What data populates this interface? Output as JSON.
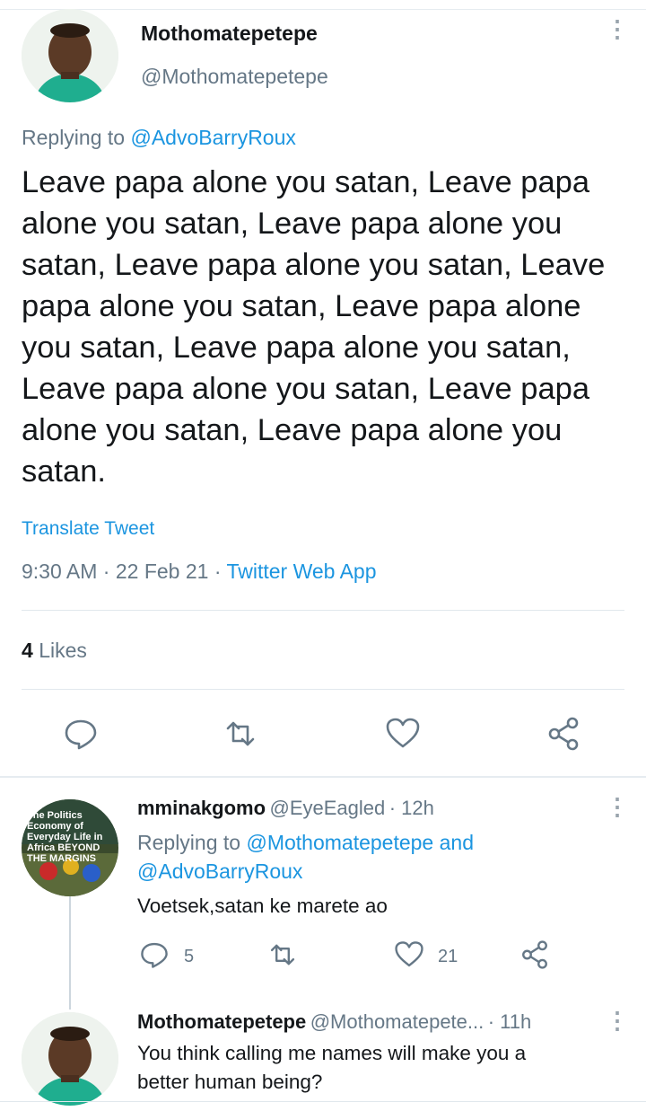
{
  "tweet": {
    "author_name": "Mothomatepetepe",
    "author_handle": "@Mothomatepetepe",
    "replying_prefix": "Replying to ",
    "replying_to": "@AdvoBarryRoux",
    "text": "Leave papa alone you satan, Leave papa alone you satan, Leave papa alone you satan, Leave papa alone you satan, Leave papa alone you satan, Leave papa alone you satan, Leave papa alone you satan, Leave papa alone you satan, Leave papa alone you satan, Leave papa alone you satan.",
    "translate_label": "Translate Tweet",
    "time": "9:30 AM",
    "date": "22 Feb 21",
    "source": "Twitter Web App",
    "likes_count": "4",
    "likes_label": "Likes",
    "actions": [
      "comment-icon",
      "retweet-icon",
      "like-icon",
      "share-icon"
    ]
  },
  "replies": [
    {
      "name": "mminakgomo",
      "handle": "@EyeEagled",
      "time": "12h",
      "replying_prefix": "Replying to ",
      "replying_to_1": "@Mothomatepetepe",
      "replying_and": " and",
      "replying_to_2": "@AdvoBarryRoux",
      "text": "Voetsek,satan ke marete ao",
      "reply_count": "5",
      "like_count": "21",
      "avatar_text": "The Politics Economy of Everyday Life in Africa BEYOND THE MARGINS"
    },
    {
      "name": "Mothomatepetepe",
      "handle": "@Mothomatepete...",
      "time": "11h",
      "text_line1": "You think calling me names will make you a",
      "text_line2": "better human being?"
    }
  ],
  "colors": {
    "accent": "#1b95e0",
    "secondary_text": "#657786",
    "primary_text": "#14171a",
    "divider": "#e1e8ed"
  }
}
